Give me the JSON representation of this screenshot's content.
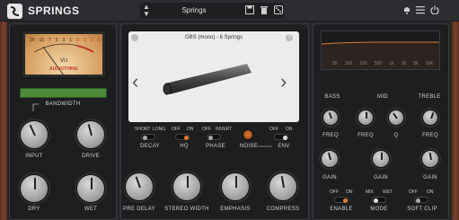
{
  "app": {
    "title": "SPRINGS"
  },
  "preset": {
    "name": "Springs"
  },
  "left": {
    "vu_label": "VU",
    "vu_brand": "AUDIOTHING",
    "vu_scale": [
      "20",
      "10",
      "7",
      "5",
      "3",
      "1",
      "0",
      "1",
      "2",
      "3"
    ],
    "bandwidth_label": "BANDWIDTH",
    "knobs": [
      {
        "label": "INPUT"
      },
      {
        "label": "DRIVE"
      },
      {
        "label": "DRY"
      },
      {
        "label": "WET"
      }
    ]
  },
  "center": {
    "spring_title": "GBS (mono) - 6 Springs",
    "decay": {
      "label": "DECAY",
      "opt_a": "SHORT",
      "opt_b": "LONG"
    },
    "hq": {
      "label": "HQ",
      "opt_a": "OFF",
      "opt_b": "ON"
    },
    "phase": {
      "label": "PHASE",
      "opt_a": "OFF",
      "opt_b": "INVERT"
    },
    "noise_label": "NOISE",
    "env": {
      "label": "ENV",
      "opt_a": "OFF",
      "opt_b": "ON"
    },
    "knobs": [
      {
        "label": "PRE DELAY"
      },
      {
        "label": "STEREO WIDTH"
      },
      {
        "label": "EMPHASIS"
      },
      {
        "label": "COMPRESS"
      }
    ]
  },
  "right": {
    "freq_ticks": [
      "50",
      "100",
      "200",
      "500",
      "1k",
      "2k",
      "5k",
      "10k"
    ],
    "bass_label": "BASS",
    "mid_label": "MID",
    "treble_label": "TREBLE",
    "freq_label": "FREQ",
    "q_label": "Q",
    "gain_label": "GAIN",
    "enable": {
      "label": "ENABLE",
      "opt_a": "OFF",
      "opt_b": "ON"
    },
    "mode": {
      "label": "MODE",
      "opt_a": "MIX",
      "opt_b": "WET"
    },
    "softclip": {
      "label": "SOFT CLIP",
      "opt_a": "OFF",
      "opt_b": "ON"
    }
  },
  "colors": {
    "accent_orange": "#e07a2e",
    "led_green": "#4a8a3a",
    "vu_red": "#c0392b"
  }
}
